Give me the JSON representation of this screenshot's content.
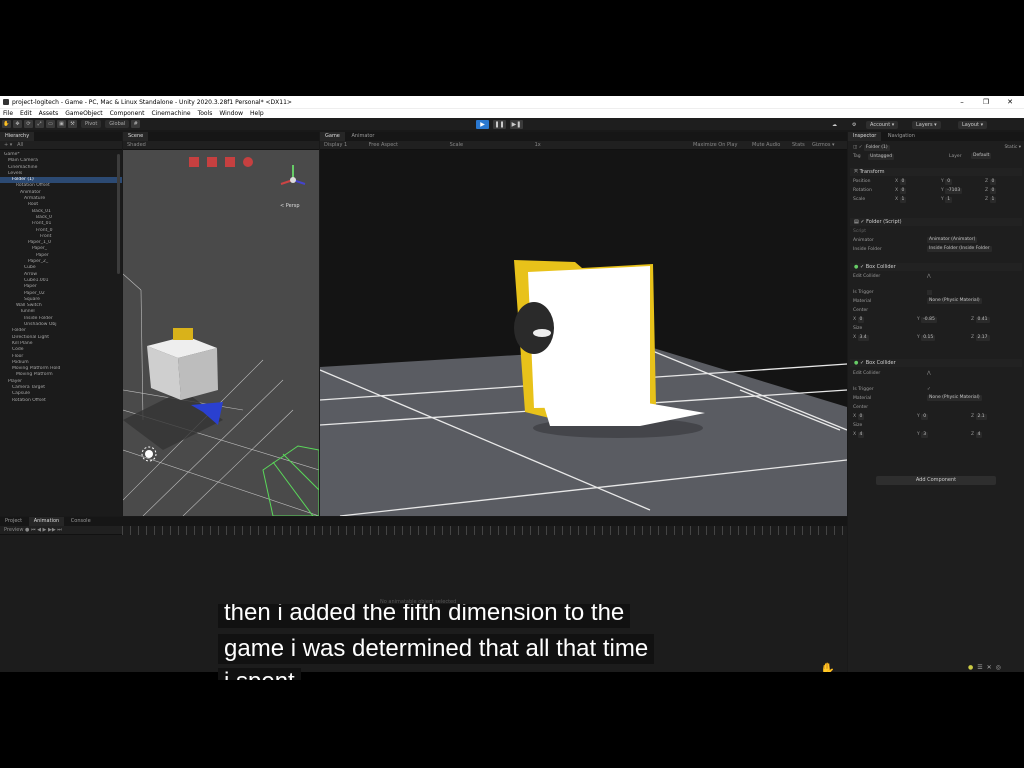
{
  "titlebar": {
    "text": "project-logitech - Game - PC, Mac & Linux Standalone - Unity 2020.3.28f1 Personal* <DX11>",
    "min": "–",
    "max": "❐",
    "close": "✕"
  },
  "menu": [
    "File",
    "Edit",
    "Assets",
    "GameObject",
    "Component",
    "Cinemachine",
    "Tools",
    "Window",
    "Help"
  ],
  "toolbar": {
    "pivot": "Pivot",
    "global": "Global",
    "account": "Account ▾",
    "layers": "Layers ▾",
    "layout": "Layout ▾"
  },
  "hierarchy": {
    "tab": "Hierarchy",
    "search_placeholder": "All",
    "items": [
      "Game*",
      "Main Camera",
      "Cinemachine",
      "Levels",
      "Folder (1)",
      "Rotation Offset",
      "Animator",
      "Armature",
      "Root",
      "Back_01",
      "Back_0",
      "Front_01",
      "Front_0",
      "Front",
      "Paper_1_0",
      "Paper_",
      "Paper",
      "Paper_2_",
      "Cube",
      "Arrow",
      "Cube1.001",
      "Paper",
      "Paper_02",
      "Square",
      "Wall Switch",
      "",
      "Tunnel",
      "Inside Folder",
      "Unshadow Obj",
      "Folder",
      "Directional Light",
      "Kill Plane",
      "Code",
      "Floor",
      "Podium",
      "Moving Platform Hold",
      "Moving Platform",
      "",
      "Player",
      "Camera Target",
      "Capsule",
      "Rotation Offset"
    ]
  },
  "scene": {
    "tab": "Scene",
    "shaded": "Shaded",
    "gizmo_label": "< Persp"
  },
  "game": {
    "tab": "Game",
    "animator_tab": "Animator",
    "display": "Display 1",
    "aspect": "Free Aspect",
    "scale": "Scale",
    "scale_val": "1x",
    "maximize": "Maximize On Play",
    "mute": "Mute Audio",
    "stats": "Stats",
    "gizmos": "Gizmos ▾"
  },
  "inspector": {
    "tab": "Inspector",
    "nav_tab": "Navigation",
    "object_name": "Folder (1)",
    "static": "Static ▾",
    "tag_label": "Tag",
    "tag": "Untagged",
    "layer_label": "Layer",
    "layer": "Default",
    "transform": "Transform",
    "position": {
      "label": "Position",
      "x": "0",
      "y": "0",
      "z": "0"
    },
    "rotation": {
      "label": "Rotation",
      "x": "0",
      "y": "-7103",
      "z": "0"
    },
    "scale": {
      "label": "Scale",
      "x": "1",
      "y": "1",
      "z": "1"
    },
    "folder_script": "Folder (Script)",
    "script_label": "Script",
    "animator_label": "Animator",
    "animator_val": "Animator (Animator)",
    "inside_label": "Inside Folder",
    "inside_val": "Inside Folder (Inside Folder",
    "box1": "Box Collider",
    "edit_collider": "Edit Collider",
    "is_trigger": "Is Trigger",
    "material_label": "Material",
    "material_val": "None (Physic Material)",
    "center_label": "Center",
    "c1": {
      "x": "0",
      "y": "-0.85",
      "z": "0.41"
    },
    "size_label": "Size",
    "s1": {
      "x": "3.4",
      "y": "0.15",
      "z": "2.17"
    },
    "box2": "Box Collider",
    "is_trigger_check": "✓",
    "c2": {
      "x": "0",
      "y": "0",
      "z": "2.1"
    },
    "s2": {
      "x": "4",
      "y": "3",
      "z": "4"
    },
    "add_component": "Add Component"
  },
  "bottom": {
    "tabs": [
      "Project",
      "Animation",
      "Console"
    ],
    "preview": "Preview",
    "no_animator": "No animatable object selected"
  },
  "subtitle": {
    "line1": "then i added the fifth dimension to the",
    "line2": "game i was determined that all that time",
    "line3": "i spent"
  },
  "colors": {
    "accent": "#2a78d0",
    "folder_yellow": "#e8c21a",
    "subtitle_bg": "#111111"
  }
}
